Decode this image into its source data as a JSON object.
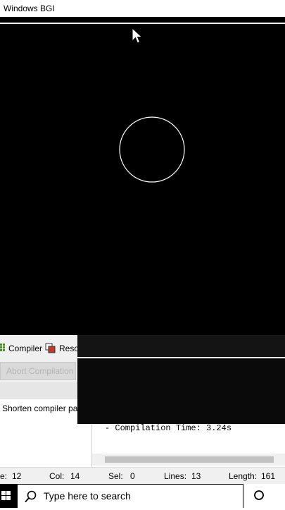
{
  "bgi_window": {
    "title": "Windows BGI"
  },
  "ide": {
    "tabs": [
      {
        "label": "Compiler",
        "icon": "compiler-grid-icon"
      },
      {
        "label": "Reso",
        "icon": "resources-icon"
      }
    ],
    "abort_button": "Abort Compilation",
    "shorten_label": "Shorten compiler path",
    "log_line": "- Compilation Time: 3.24s"
  },
  "statusbar": {
    "line_label": "e:",
    "line_value": "12",
    "col_label": "Col:",
    "col_value": "14",
    "sel_label": "Sel:",
    "sel_value": "0",
    "lines_label": "Lines:",
    "lines_value": "13",
    "length_label": "Length:",
    "length_value": "161"
  },
  "taskbar": {
    "search_placeholder": "Type here to search"
  },
  "colors": {
    "canvas": "#000000",
    "circle": "#ffffff"
  }
}
